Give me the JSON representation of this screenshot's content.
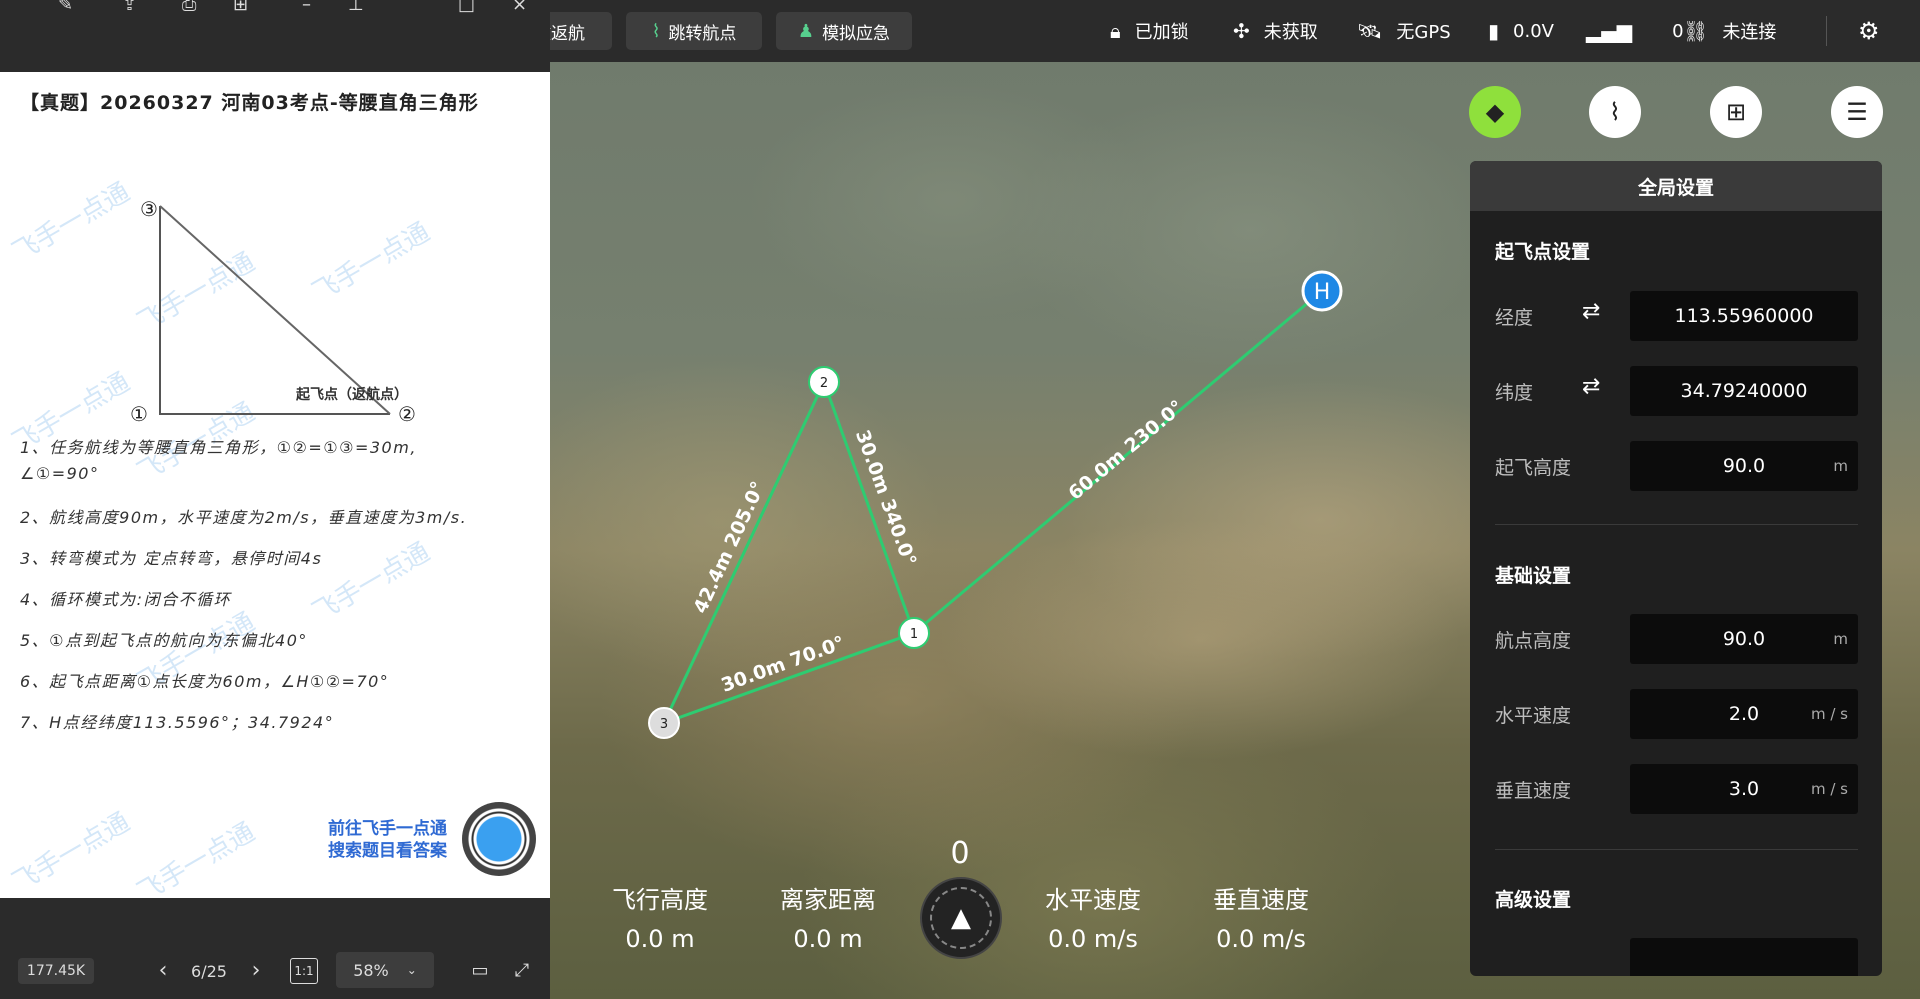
{
  "toolbar": {
    "buttons": [
      "一键返航",
      "跳转航点",
      "模拟应急"
    ],
    "status": {
      "lock": "已加锁",
      "drone": "未获取",
      "gps": "无GPS",
      "voltage": "0.0V",
      "signal": "0",
      "connection": "未连接"
    }
  },
  "viewer": {
    "doc_title": "【真题】20260327 河南03考点-等腰直角三角形",
    "diagram_labels": {
      "p3": "③",
      "p1": "①",
      "p2": "②",
      "takeoff": "起飞点（返航点）"
    },
    "watermark": "飞手一点通",
    "requirements": [
      "1、任务航线为等腰直角三角形，①②=①③=30m,",
      "∠①=90°",
      "2、航线高度90m，水平速度为2m/s，垂直速度为3m/s.",
      "3、转弯模式为 定点转弯，悬停时间4s",
      "4、循环模式为:闭合不循环",
      "5、①点到起飞点的航向为东偏北40°",
      "6、起飞点距离①点长度为60m，∠H①②=70°",
      "7、H点经纬度113.5596°；34.7924°"
    ],
    "promo": [
      "前往飞手一点通",
      "搜索题目看答案"
    ],
    "file_size": "177.45K",
    "page": "6/25",
    "ratio_button": "1:1",
    "zoom": "58%"
  },
  "map": {
    "home_label": "H",
    "waypoints": [
      "1",
      "2",
      "3"
    ],
    "segments": [
      "60.0m 230.0°",
      "30.0m 340.0°",
      "42.4m 205.0°",
      "30.0m 70.0°"
    ]
  },
  "settings": {
    "title": "全局设置",
    "takeoff_section": "起飞点设置",
    "longitude": {
      "label": "经度",
      "value": "113.55960000"
    },
    "latitude": {
      "label": "纬度",
      "value": "34.79240000"
    },
    "takeoff_alt": {
      "label": "起飞高度",
      "value": "90.0",
      "unit": "m"
    },
    "basic_section": "基础设置",
    "wp_alt": {
      "label": "航点高度",
      "value": "90.0",
      "unit": "m"
    },
    "h_speed": {
      "label": "水平速度",
      "value": "2.0",
      "unit": "m / s"
    },
    "v_speed": {
      "label": "垂直速度",
      "value": "3.0",
      "unit": "m / s"
    },
    "advanced_section": "高级设置"
  },
  "telemetry": {
    "heading": "0",
    "altitude": {
      "label": "飞行高度",
      "value": "0.0 m"
    },
    "home_dist": {
      "label": "离家距离",
      "value": "0.0 m"
    },
    "h_speed": {
      "label": "水平速度",
      "value": "0.0 m/s"
    },
    "v_speed": {
      "label": "垂直速度",
      "value": "0.0 m/s"
    }
  },
  "colors": {
    "route": "#2ecc71",
    "accent": "#8fe03c",
    "home": "#1e88e5"
  }
}
